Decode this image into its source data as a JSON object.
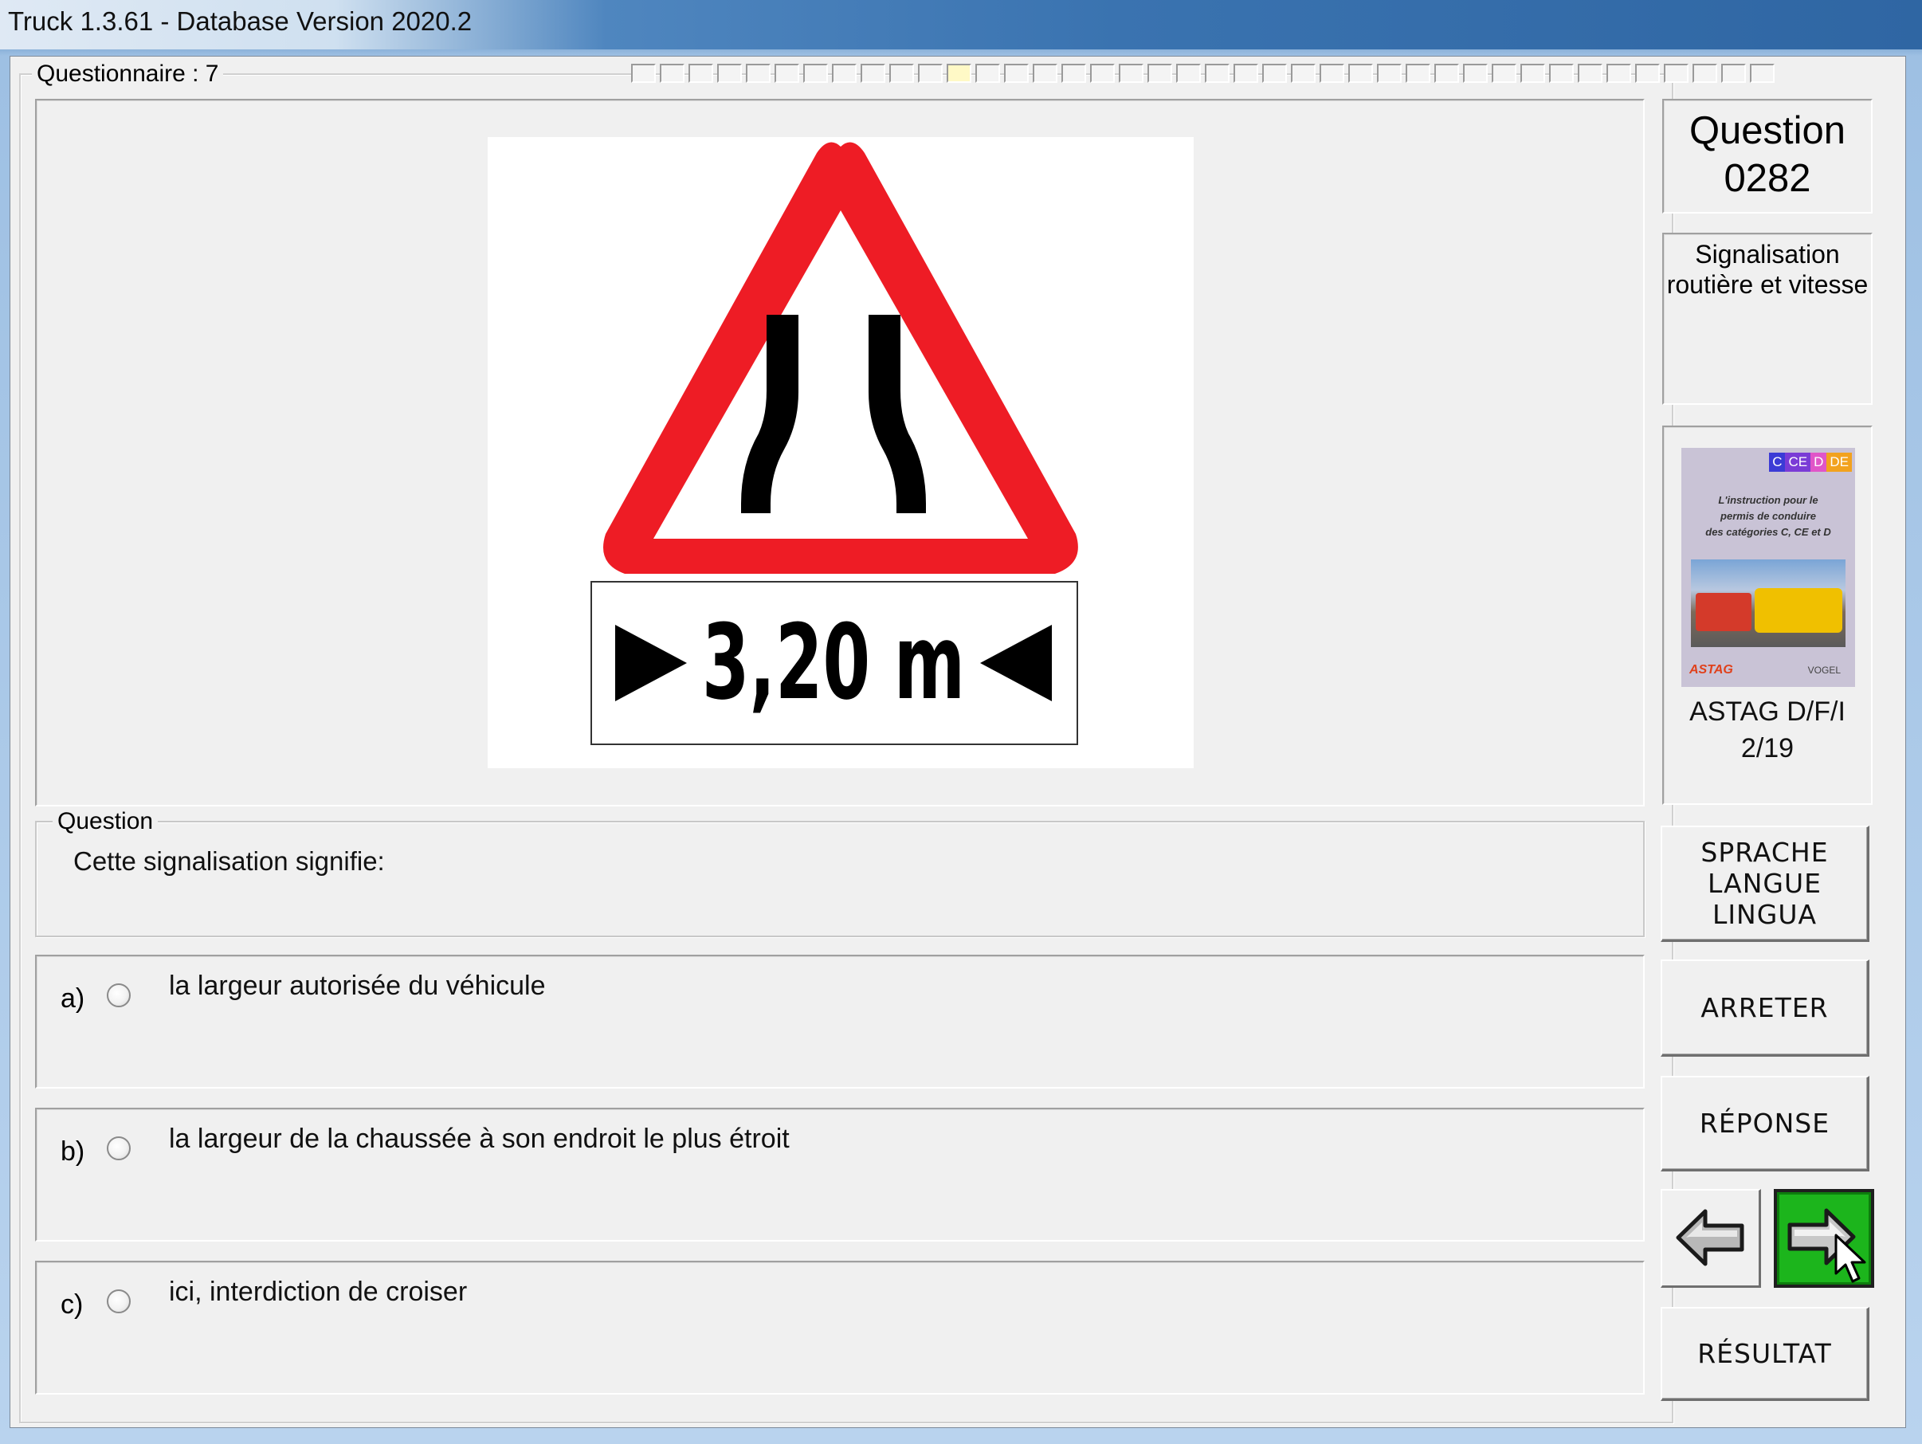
{
  "window": {
    "title": "Truck 1.3.61 - Database Version 2020.2"
  },
  "questionnaire": {
    "label": "Questionnaire : 7",
    "progress_total": 40,
    "progress_current": 12
  },
  "sign": {
    "distance_text": "3,20 m",
    "colors": {
      "border": "#ee1c25",
      "fill": "#ffffff",
      "symbol": "#000000"
    }
  },
  "question": {
    "legend": "Question",
    "text": "Cette signalisation signifie:"
  },
  "answers": [
    {
      "letter": "a)",
      "text": "la largeur autorisée du véhicule"
    },
    {
      "letter": "b)",
      "text": "la largeur de la chaussée à son endroit le plus étroit"
    },
    {
      "letter": "c)",
      "text": "ici, interdiction de croiser"
    }
  ],
  "sidebar": {
    "question_label": "Question",
    "question_number": "0282",
    "category_line1": "Signalisation",
    "category_line2": "routière et vitesse",
    "book": {
      "cover_tags": [
        "C",
        "CE",
        "D",
        "DE"
      ],
      "cover_text_1": "L'instruction pour le",
      "cover_text_2": "permis de conduire",
      "cover_text_3": "des catégories C, CE et D",
      "publisher_left": "ASTAG",
      "publisher_right": "VOGEL",
      "caption_line1": "ASTAG D/F/I",
      "caption_line2": "2/19"
    }
  },
  "buttons": {
    "language_line1": "SPRACHE",
    "language_line2": "LANGUE",
    "language_line3": "LINGUA",
    "stop": "ARRETER",
    "answer": "RÉPONSE",
    "result": "RÉSULTAT",
    "prev_icon": "arrow-left-icon",
    "next_icon": "arrow-right-icon",
    "next_color": "#1cb51c"
  }
}
